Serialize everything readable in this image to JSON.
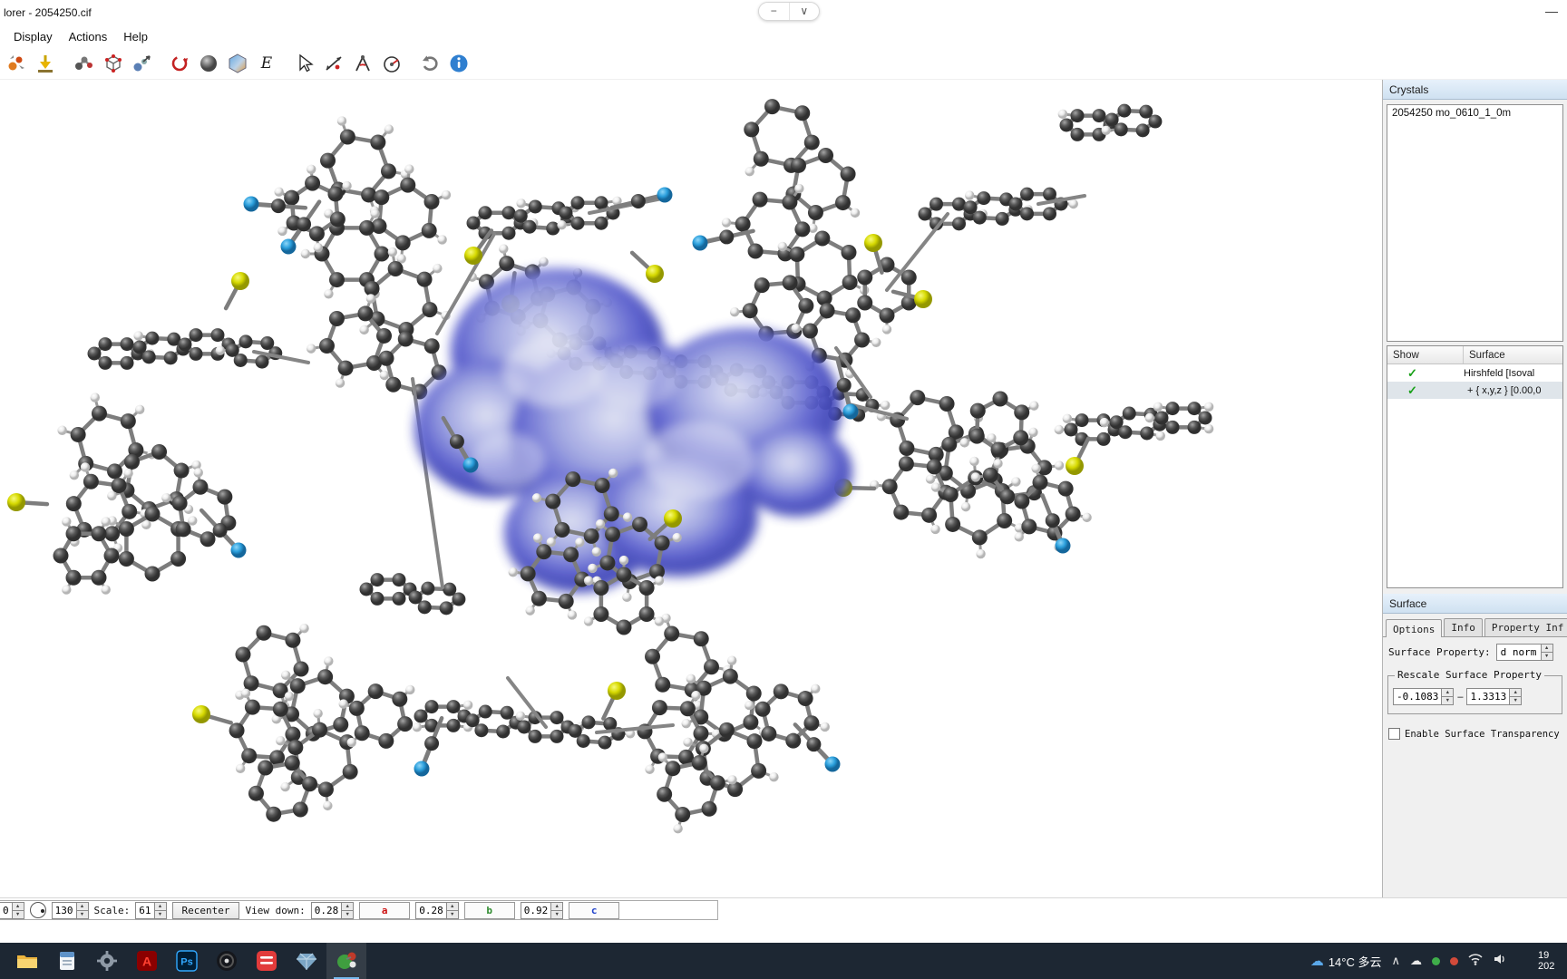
{
  "window": {
    "title": "lorer - 2054250.cif",
    "minimize": "—"
  },
  "glyphs": {
    "minus": "−",
    "chevron_down": "∨",
    "chevron_up": "∧",
    "spin_up": "▲",
    "spin_down": "▼",
    "cloud": "☁",
    "weather_cloud": "☁"
  },
  "menu": {
    "items": [
      {
        "label": "Display"
      },
      {
        "label": "Actions"
      },
      {
        "label": "Help"
      }
    ]
  },
  "toolbar": {
    "energy_label": "E",
    "icons": [
      "generate-fragments",
      "save-structure",
      "atoms",
      "unit-cell",
      "molecule-arrow",
      "reset-red",
      "sphere",
      "surface",
      "energy",
      "select-cursor",
      "measure-distance",
      "measure-angle",
      "measure-radius",
      "undo",
      "info"
    ]
  },
  "crystals": {
    "header": "Crystals",
    "items": [
      {
        "label": "2054250 mo_0610_1_0m"
      }
    ],
    "columns": {
      "show": "Show",
      "surface": "Surface"
    },
    "rows": [
      {
        "check": "✓",
        "label": "Hirshfeld [Isoval"
      },
      {
        "check": "✓",
        "label": "+ { x,y,z } [0.00,0"
      }
    ]
  },
  "surface": {
    "header": "Surface",
    "tabs": [
      {
        "label": "Options"
      },
      {
        "label": "Info"
      },
      {
        "label": "Property Inf"
      }
    ],
    "property_label": "Surface Property:",
    "property_value": "d norm",
    "rescale_title": "Rescale Surface Property",
    "min": "-0.1083",
    "dash": "–",
    "max": "1.3313",
    "transparency_label": "Enable Surface Transparency"
  },
  "bottom": {
    "spin_a": "0",
    "spin_b": "130",
    "scale_label": "Scale:",
    "scale_value": "61",
    "recenter": "Recenter",
    "view_down_label": "View down:",
    "axis_a_value": "0.28",
    "axis_a": "a",
    "axis_b_value": "0.28",
    "axis_b": "b",
    "axis_c_value": "0.92",
    "axis_c": "c"
  },
  "taskbar": {
    "weather": "14°C 多云",
    "ps_label": "Ps",
    "acrobat_label": "A",
    "clock_line1": "19",
    "clock_line2": "202"
  },
  "colors": {
    "carbon": "#4d4d4d",
    "hydrogen": "#f0f0f0",
    "nitrogen": "#2b9fdc",
    "sulfur": "#d6d900",
    "surface_blue": "#5156c8",
    "panel_header": "#d8e6f3"
  }
}
